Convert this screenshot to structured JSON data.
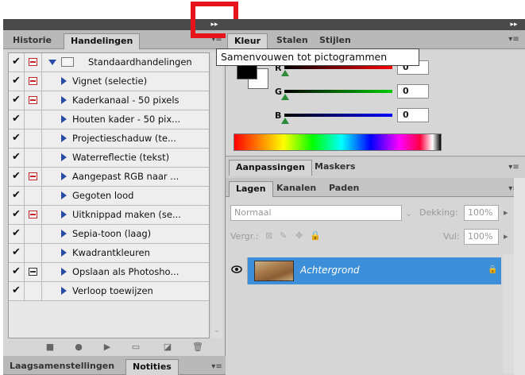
{
  "collapse_button": {
    "glyph": "▸▸",
    "tooltip": "Samenvouwen tot pictogrammen"
  },
  "left_panel": {
    "tabs": [
      {
        "label": "Historie",
        "active": false
      },
      {
        "label": "Handelingen",
        "active": true
      }
    ],
    "actions": [
      {
        "label": "Standaardhandelingen",
        "checked": true,
        "dialog": "red",
        "kind": "set"
      },
      {
        "label": "Vignet (selectie)",
        "checked": true,
        "dialog": "red",
        "kind": "action"
      },
      {
        "label": "Kaderkanaal - 50 pixels",
        "checked": true,
        "dialog": "red",
        "kind": "action"
      },
      {
        "label": "Houten kader - 50 pix...",
        "checked": true,
        "dialog": "none",
        "kind": "action"
      },
      {
        "label": "Projectieschaduw (te...",
        "checked": true,
        "dialog": "none",
        "kind": "action"
      },
      {
        "label": "Waterreflectie (tekst)",
        "checked": true,
        "dialog": "none",
        "kind": "action"
      },
      {
        "label": "Aangepast RGB naar ...",
        "checked": true,
        "dialog": "red",
        "kind": "action"
      },
      {
        "label": "Gegoten lood",
        "checked": true,
        "dialog": "none",
        "kind": "action"
      },
      {
        "label": "Uitknippad maken (se...",
        "checked": true,
        "dialog": "red",
        "kind": "action"
      },
      {
        "label": "Sepia-toon (laag)",
        "checked": true,
        "dialog": "none",
        "kind": "action"
      },
      {
        "label": "Kwadrantkleuren",
        "checked": true,
        "dialog": "none",
        "kind": "action"
      },
      {
        "label": "Opslaan als Photosho...",
        "checked": true,
        "dialog": "dark",
        "kind": "action"
      },
      {
        "label": "Verloop toewijzen",
        "checked": true,
        "dialog": "none",
        "kind": "action"
      }
    ],
    "toolbar_icons": [
      "stop-icon",
      "record-icon",
      "play-icon",
      "new-set-icon",
      "new-action-icon",
      "trash-icon"
    ],
    "bottom_tabs": [
      {
        "label": "Laagsamenstellingen",
        "active": false
      },
      {
        "label": "Notities",
        "active": true
      }
    ]
  },
  "color_panel": {
    "tabs": [
      {
        "label": "Kleur",
        "active": true
      },
      {
        "label": "Stalen",
        "active": false
      },
      {
        "label": "Stijlen",
        "active": false
      }
    ],
    "sliders": [
      {
        "label": "R",
        "value": "0",
        "color": "#ff0000"
      },
      {
        "label": "G",
        "value": "0",
        "color": "#00cc00"
      },
      {
        "label": "B",
        "value": "0",
        "color": "#0000ff"
      }
    ],
    "foreground_color": "#000000",
    "background_color": "#ffffff"
  },
  "adjust_panel": {
    "tabs": [
      {
        "label": "Aanpassingen",
        "active": true
      },
      {
        "label": "Maskers",
        "active": false
      }
    ]
  },
  "layers_panel": {
    "tabs": [
      {
        "label": "Lagen",
        "active": true
      },
      {
        "label": "Kanalen",
        "active": false
      },
      {
        "label": "Paden",
        "active": false
      }
    ],
    "blend_mode": "Normaal",
    "opacity_label": "Dekking:",
    "opacity_value": "100%",
    "lock_label": "Vergr.:",
    "fill_label": "Vul:",
    "fill_value": "100%",
    "layers": [
      {
        "name": "Achtergrond",
        "selected": true,
        "locked": true
      }
    ]
  }
}
